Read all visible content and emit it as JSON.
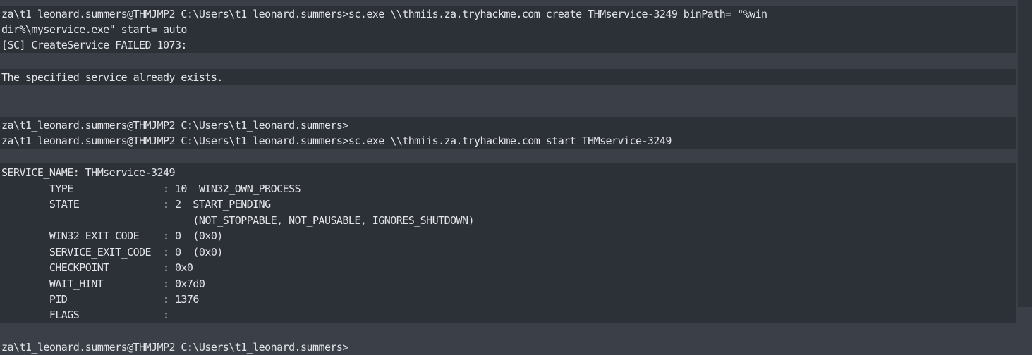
{
  "terminal": {
    "lines": [
      "za\\t1_leonard.summers@THMJMP2 C:\\Users\\t1_leonard.summers>sc.exe \\\\thmiis.za.tryhackme.com create THMservice-3249 binPath= \"%win",
      "dir%\\myservice.exe\" start= auto",
      "[SC] CreateService FAILED 1073:",
      "",
      "The specified service already exists.",
      "",
      "",
      "za\\t1_leonard.summers@THMJMP2 C:\\Users\\t1_leonard.summers>",
      "za\\t1_leonard.summers@THMJMP2 C:\\Users\\t1_leonard.summers>sc.exe \\\\thmiis.za.tryhackme.com start THMservice-3249",
      "",
      "SERVICE_NAME: THMservice-3249",
      "        TYPE               : 10  WIN32_OWN_PROCESS",
      "        STATE              : 2  START_PENDING",
      "                                (NOT_STOPPABLE, NOT_PAUSABLE, IGNORES_SHUTDOWN)",
      "        WIN32_EXIT_CODE    : 0  (0x0)",
      "        SERVICE_EXIT_CODE  : 0  (0x0)",
      "        CHECKPOINT         : 0x0",
      "        WAIT_HINT          : 0x7d0",
      "        PID                : 1376",
      "        FLAGS              :",
      "",
      "za\\t1_leonard.summers@THMJMP2 C:\\Users\\t1_leonard.summers>"
    ]
  },
  "colors": {
    "background": "#3b4048",
    "band": "#2c3037",
    "text": "#e2e4e8"
  }
}
